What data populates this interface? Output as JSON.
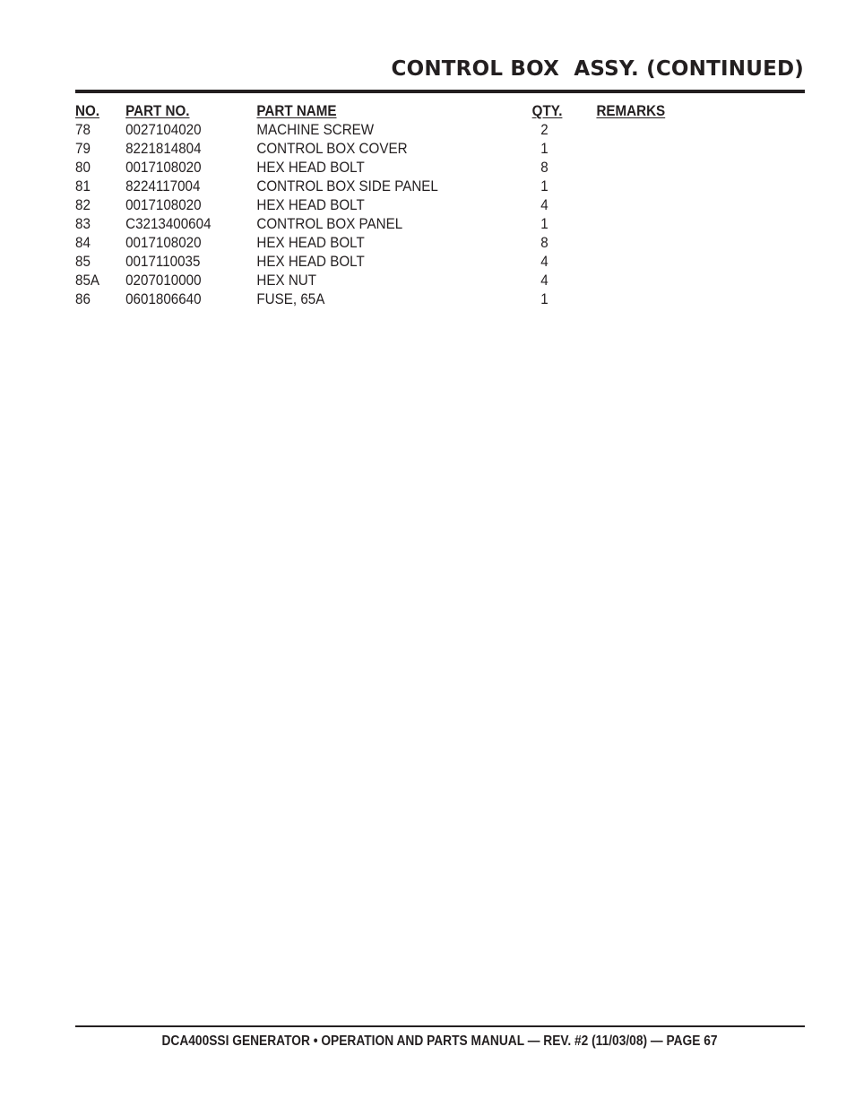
{
  "page": {
    "title": "CONTROL BOX  ASSY. (CONTINUED)"
  },
  "table": {
    "headers": {
      "no": "NO.",
      "part_no": "PART NO.",
      "part_name": "PART NAME",
      "qty": "QTY.",
      "remarks": "REMARKS"
    },
    "rows": [
      {
        "no": "78",
        "part_no": "0027104020",
        "part_name": "MACHINE SCREW",
        "qty": "2",
        "remarks": ""
      },
      {
        "no": "79",
        "part_no": "8221814804",
        "part_name": "CONTROL BOX COVER",
        "qty": "1",
        "remarks": ""
      },
      {
        "no": "80",
        "part_no": "0017108020",
        "part_name": "HEX HEAD BOLT",
        "qty": "8",
        "remarks": ""
      },
      {
        "no": "81",
        "part_no": "8224117004",
        "part_name": "CONTROL BOX SIDE PANEL",
        "qty": "1",
        "remarks": ""
      },
      {
        "no": "82",
        "part_no": "0017108020",
        "part_name": "HEX HEAD BOLT",
        "qty": "4",
        "remarks": ""
      },
      {
        "no": "83",
        "part_no": "C3213400604",
        "part_name": "CONTROL BOX PANEL",
        "qty": "1",
        "remarks": ""
      },
      {
        "no": "84",
        "part_no": "0017108020",
        "part_name": "HEX HEAD BOLT",
        "qty": "8",
        "remarks": ""
      },
      {
        "no": "85",
        "part_no": "0017110035",
        "part_name": "HEX HEAD BOLT",
        "qty": "4",
        "remarks": ""
      },
      {
        "no": "85A",
        "part_no": "0207010000",
        "part_name": "HEX NUT",
        "qty": "4",
        "remarks": ""
      },
      {
        "no": "86",
        "part_no": "0601806640",
        "part_name": "FUSE, 65A",
        "qty": "1",
        "remarks": ""
      }
    ]
  },
  "footer": {
    "text": "DCA400SSI GENERATOR • OPERATION AND PARTS MANUAL — REV. #2 (11/03/08) — PAGE 67"
  }
}
